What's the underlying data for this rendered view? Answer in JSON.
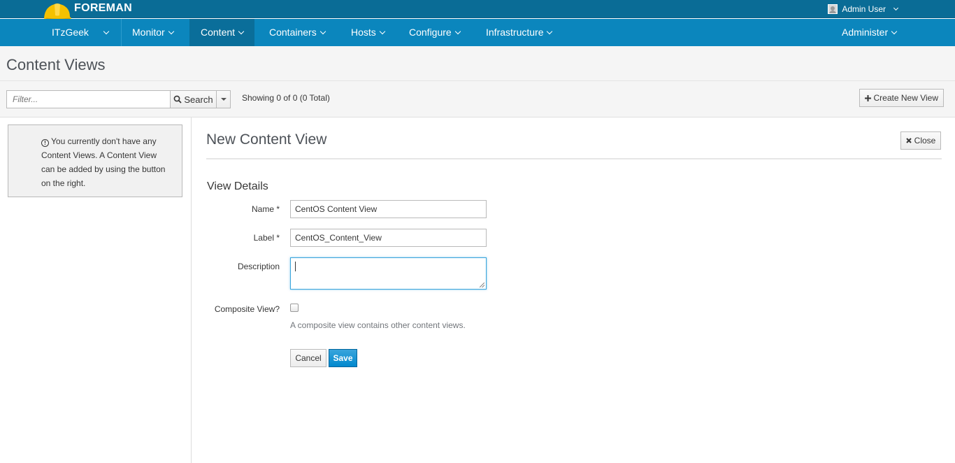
{
  "brand": {
    "name": "FOREMAN",
    "logo_icon": "hardhat-icon",
    "logo_color": "#f5c100"
  },
  "user_menu": {
    "label": "Admin User",
    "icon": "user-avatar-icon"
  },
  "nav": {
    "items": [
      {
        "label": "ITzGeek"
      },
      {
        "label": "Monitor"
      },
      {
        "label": "Content"
      },
      {
        "label": "Containers"
      },
      {
        "label": "Hosts"
      },
      {
        "label": "Configure"
      },
      {
        "label": "Infrastructure"
      },
      {
        "label": "Administer"
      }
    ],
    "active": "Content",
    "colors": {
      "brandbar": "#0a6c96",
      "navbar": "#0b86bd"
    }
  },
  "page": {
    "title": "Content Views"
  },
  "toolbar": {
    "filter_placeholder": "Filter...",
    "search_label": "Search",
    "showing_text": "Showing 0 of 0 (0 Total)",
    "create_label": "Create New View"
  },
  "empty_state": {
    "message": "You currently don't have any Content Views. A Content View can be added by using the button on the right."
  },
  "form": {
    "title": "New Content View",
    "close_label": "Close",
    "section_title": "View Details",
    "name_label": "Name *",
    "name_value": "CentOS Content View",
    "label_label": "Label *",
    "label_value": "CentOS_Content_View",
    "description_label": "Description",
    "description_value": "",
    "composite_label": "Composite View?",
    "composite_checked": false,
    "composite_help": "A composite view contains other content views.",
    "cancel_label": "Cancel",
    "save_label": "Save",
    "accent_color": "#0088ce"
  }
}
